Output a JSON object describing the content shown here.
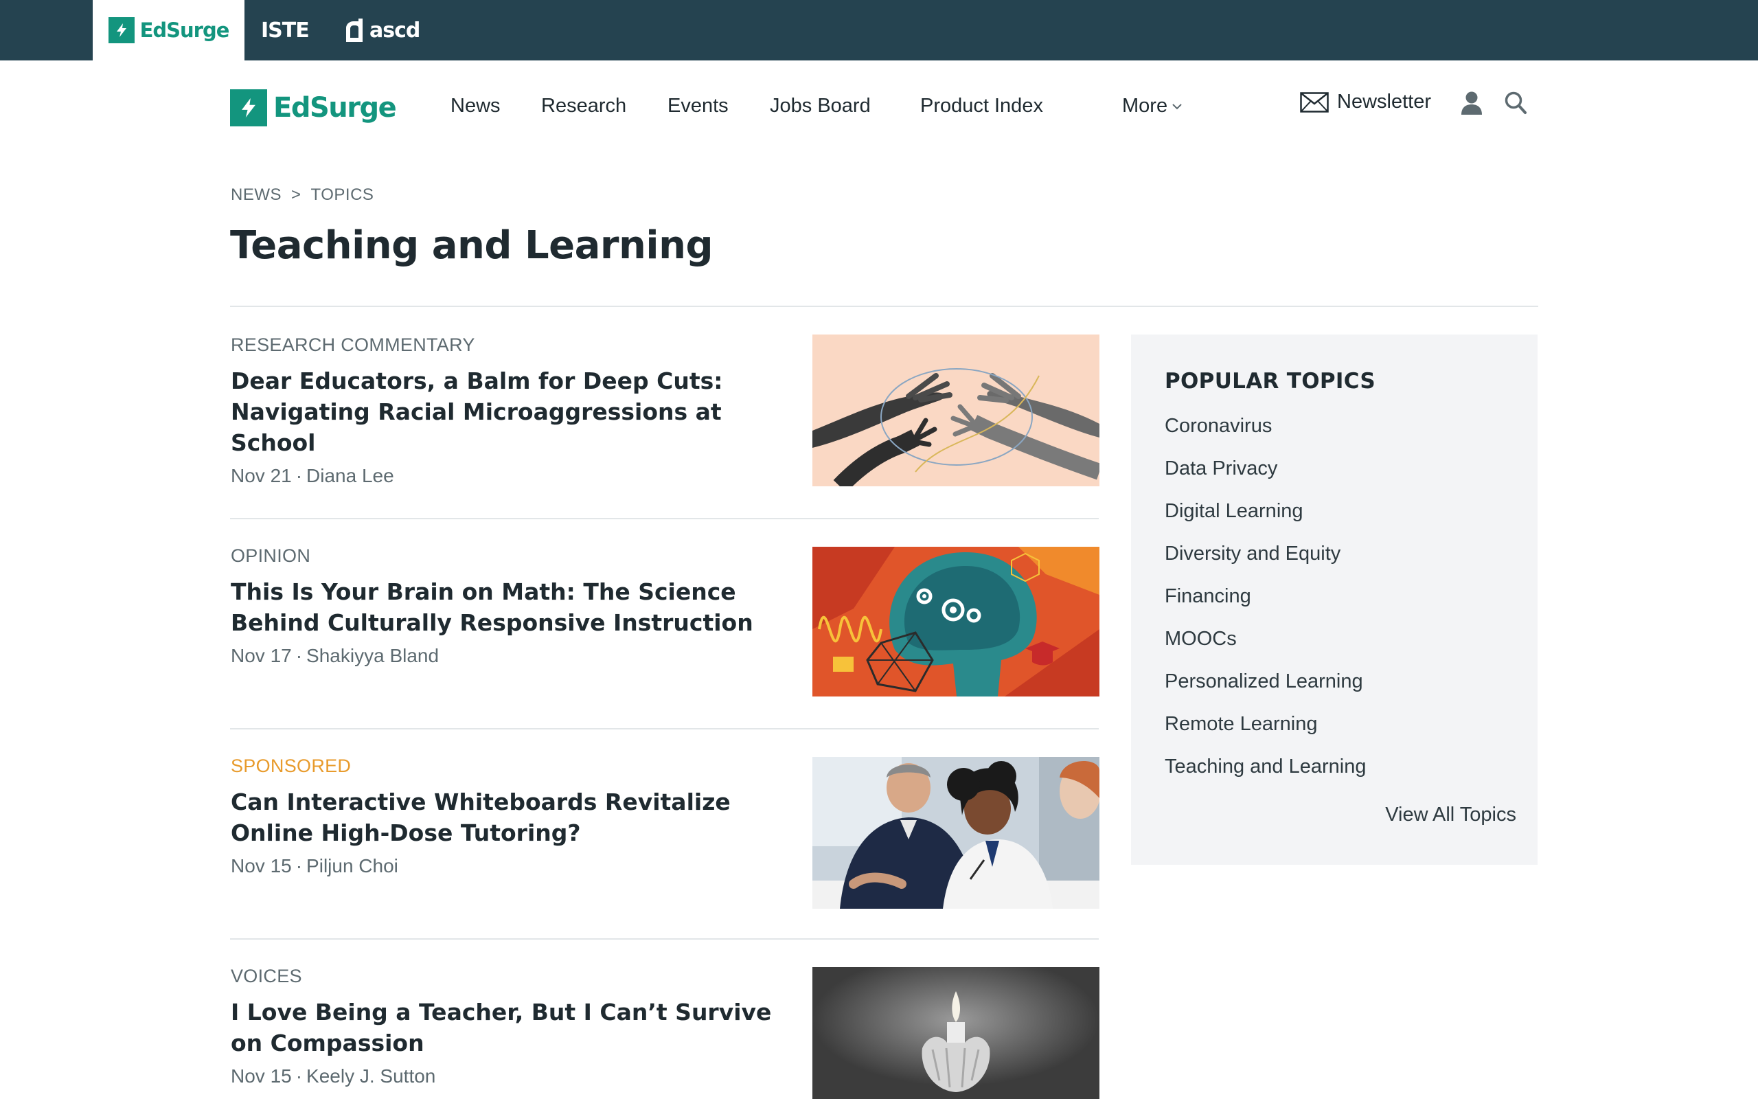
{
  "brandbar": {
    "edsurge": "EdSurge",
    "iste": "ISTE",
    "ascd": "ascd"
  },
  "nav": {
    "logo": "EdSurge",
    "items": [
      "News",
      "Research",
      "Events",
      "Jobs Board",
      "Product Index",
      "More"
    ],
    "newsletter": "Newsletter"
  },
  "breadcrumb": [
    "NEWS",
    ">",
    "TOPICS"
  ],
  "page_title": "Teaching and Learning",
  "articles": [
    {
      "kicker": "RESEARCH COMMENTARY",
      "title": "Dear Educators, a Balm for Deep Cuts: Navigating Racial Microaggressions at School",
      "date": "Nov 21",
      "author": "Diana Lee"
    },
    {
      "kicker": "OPINION",
      "title": "This Is Your Brain on Math: The Science Behind Culturally Responsive Instruction",
      "date": "Nov 17",
      "author": "Shakiyya Bland"
    },
    {
      "kicker": "SPONSORED",
      "title": "Can Interactive Whiteboards Revitalize Online High-Dose Tutoring?",
      "date": "Nov 15",
      "author": "Piljun Choi"
    },
    {
      "kicker": "VOICES",
      "title": "I Love Being a Teacher, But I Can’t Survive on Compassion",
      "date": "Nov 15",
      "author": "Keely J. Sutton"
    }
  ],
  "meta_separator": "·",
  "sidebar": {
    "heading": "POPULAR TOPICS",
    "topics": [
      "Coronavirus",
      "Data Privacy",
      "Digital Learning",
      "Diversity and Equity",
      "Financing",
      "MOOCs",
      "Personalized Learning",
      "Remote Learning",
      "Teaching and Learning"
    ],
    "view_all": "View All Topics"
  },
  "colors": {
    "brand_green": "#13957e",
    "top_bar": "#254350",
    "sponsored": "#e89b2c"
  }
}
